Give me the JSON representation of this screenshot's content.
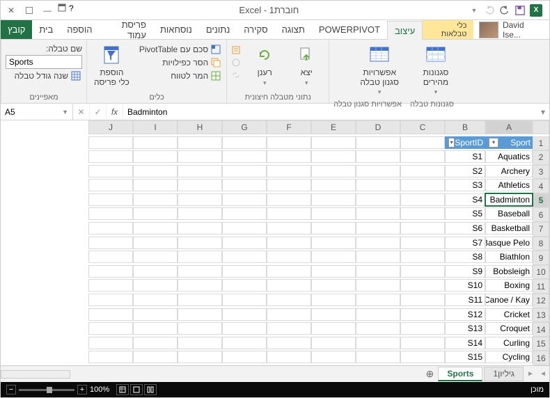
{
  "window": {
    "title": "חוברת1 - Excel"
  },
  "user": {
    "name": "David Ise..."
  },
  "tabs": {
    "file": "קובץ",
    "context_group": "כלי טבלאות",
    "items": [
      "בית",
      "הוספה",
      "פריסת עמוד",
      "נוסחאות",
      "נתונים",
      "סקירה",
      "תצוגה",
      "POWERPIVOT",
      "עיצוב"
    ],
    "active": "עיצוב"
  },
  "ribbon": {
    "properties": {
      "label": "מאפיינים",
      "table_name_label": "שם טבלה:",
      "table_name_value": "Sports",
      "resize": "שנה גודל טבלה"
    },
    "tools": {
      "label": "כלים",
      "pivot": "סכם עם PivotTable",
      "dedupe": "הסר כפילויות",
      "to_range": "המר לטווח",
      "slicer": "הוספת\nכלי פריסה"
    },
    "external": {
      "label": "נתוני מטבלה חיצונית",
      "export": "יצא",
      "refresh": "רענן"
    },
    "styleopts": {
      "label": "אפשרויות\nסגנון טבלה",
      "label2": "אפשרויות סגנון טבלה"
    },
    "styles": {
      "label": "סגנונות\nמהירים",
      "label2": "סגנונות טבלה"
    }
  },
  "formula": {
    "cellref": "A5",
    "value": "Badminton",
    "fx": "fx"
  },
  "columns": [
    "A",
    "B",
    "C",
    "D",
    "E",
    "F",
    "G",
    "H",
    "I",
    "J"
  ],
  "headers": {
    "A": "Sport",
    "B": "SportID"
  },
  "rows": [
    {
      "n": 1,
      "a": "",
      "b": ""
    },
    {
      "n": 2,
      "a": "Aquatics",
      "b": "S1"
    },
    {
      "n": 3,
      "a": "Archery",
      "b": "S2"
    },
    {
      "n": 4,
      "a": "Athletics",
      "b": "S3"
    },
    {
      "n": 5,
      "a": "Badminton",
      "b": "S4"
    },
    {
      "n": 6,
      "a": "Baseball",
      "b": "S5"
    },
    {
      "n": 7,
      "a": "Basketball",
      "b": "S6"
    },
    {
      "n": 8,
      "a": "Basque Pelo",
      "b": "S7"
    },
    {
      "n": 9,
      "a": "Biathlon",
      "b": "S8"
    },
    {
      "n": 10,
      "a": "Bobsleigh",
      "b": "S9"
    },
    {
      "n": 11,
      "a": "Boxing",
      "b": "S10"
    },
    {
      "n": 12,
      "a": "Canoe / Kay",
      "b": "S11"
    },
    {
      "n": 13,
      "a": "Cricket",
      "b": "S12"
    },
    {
      "n": 14,
      "a": "Croquet",
      "b": "S13"
    },
    {
      "n": 15,
      "a": "Curling",
      "b": "S14"
    },
    {
      "n": 16,
      "a": "Cycling",
      "b": "S15"
    }
  ],
  "sheets": {
    "items": [
      "גיליון1",
      "Sports"
    ],
    "active": "Sports"
  },
  "status": {
    "ready": "מוכן",
    "zoom": "100%"
  }
}
